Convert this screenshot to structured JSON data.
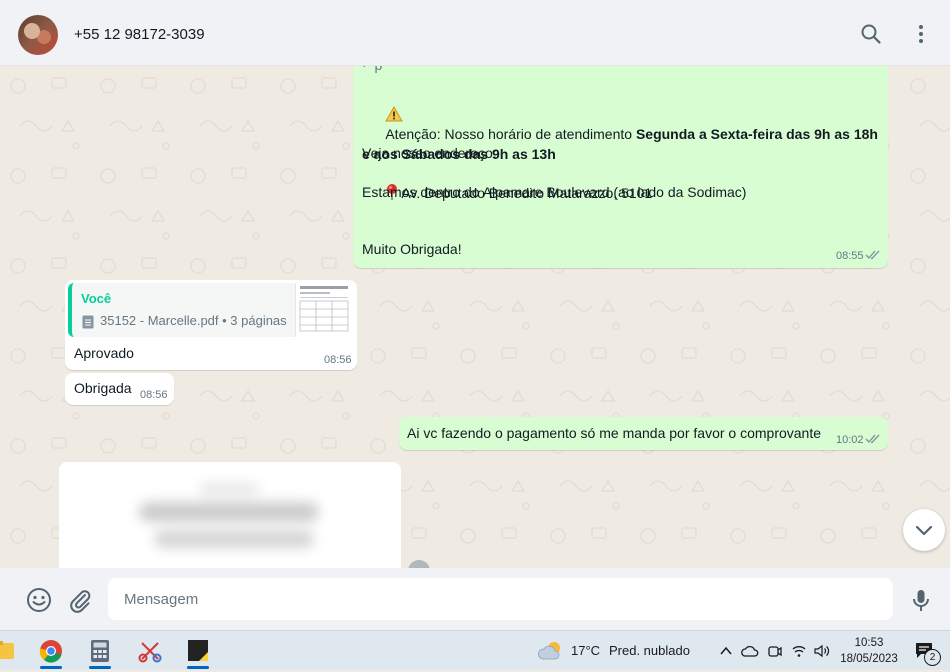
{
  "contact": {
    "name": "+55 12 98172-3039",
    "avatar": "avatar"
  },
  "header": {
    "search_icon": "search-icon",
    "menu_icon": "more-vertical-icon"
  },
  "messages": {
    "welcome": {
      "partial_top": "·  p",
      "warning_prefix": "Atenção: Nosso horário de atendimento ",
      "warning_bold": "Segunda a Sexta-feira das 9h as 18h e aos Sábados das 9h as 13h",
      "address_label": "Veja nosso endereço:",
      "address": "Av. Deputado Benedito Matarazzo, 5101",
      "location": "Estamos dentro do Alpamare Boulevard (ao lado da Sodimac)",
      "thanks": "Muito Obrigada!",
      "time": "08:55"
    },
    "approved": {
      "quote_author": "Você",
      "quote_file": "35152 - Marcelle.pdf • 3 páginas",
      "text": "Aprovado",
      "time": "08:56"
    },
    "thanks_in": {
      "text": "Obrigada",
      "time": "08:56"
    },
    "payment": {
      "text": "Ai vc fazendo o pagamento só me manda por favor o comprovante",
      "time": "10:02"
    }
  },
  "composer": {
    "placeholder": "Mensagem",
    "emoji_icon": "emoji-icon",
    "attach_icon": "paperclip-icon",
    "mic_icon": "microphone-icon"
  },
  "taskbar": {
    "weather_temp": "17°C",
    "weather_text": "Pred. nublado",
    "time": "10:53",
    "date": "18/05/2023",
    "notification_count": "2"
  },
  "colors": {
    "outgoing": "#d9fdd3",
    "incoming": "#ffffff",
    "accent": "#06cf9c",
    "tick": "#8696a0"
  }
}
